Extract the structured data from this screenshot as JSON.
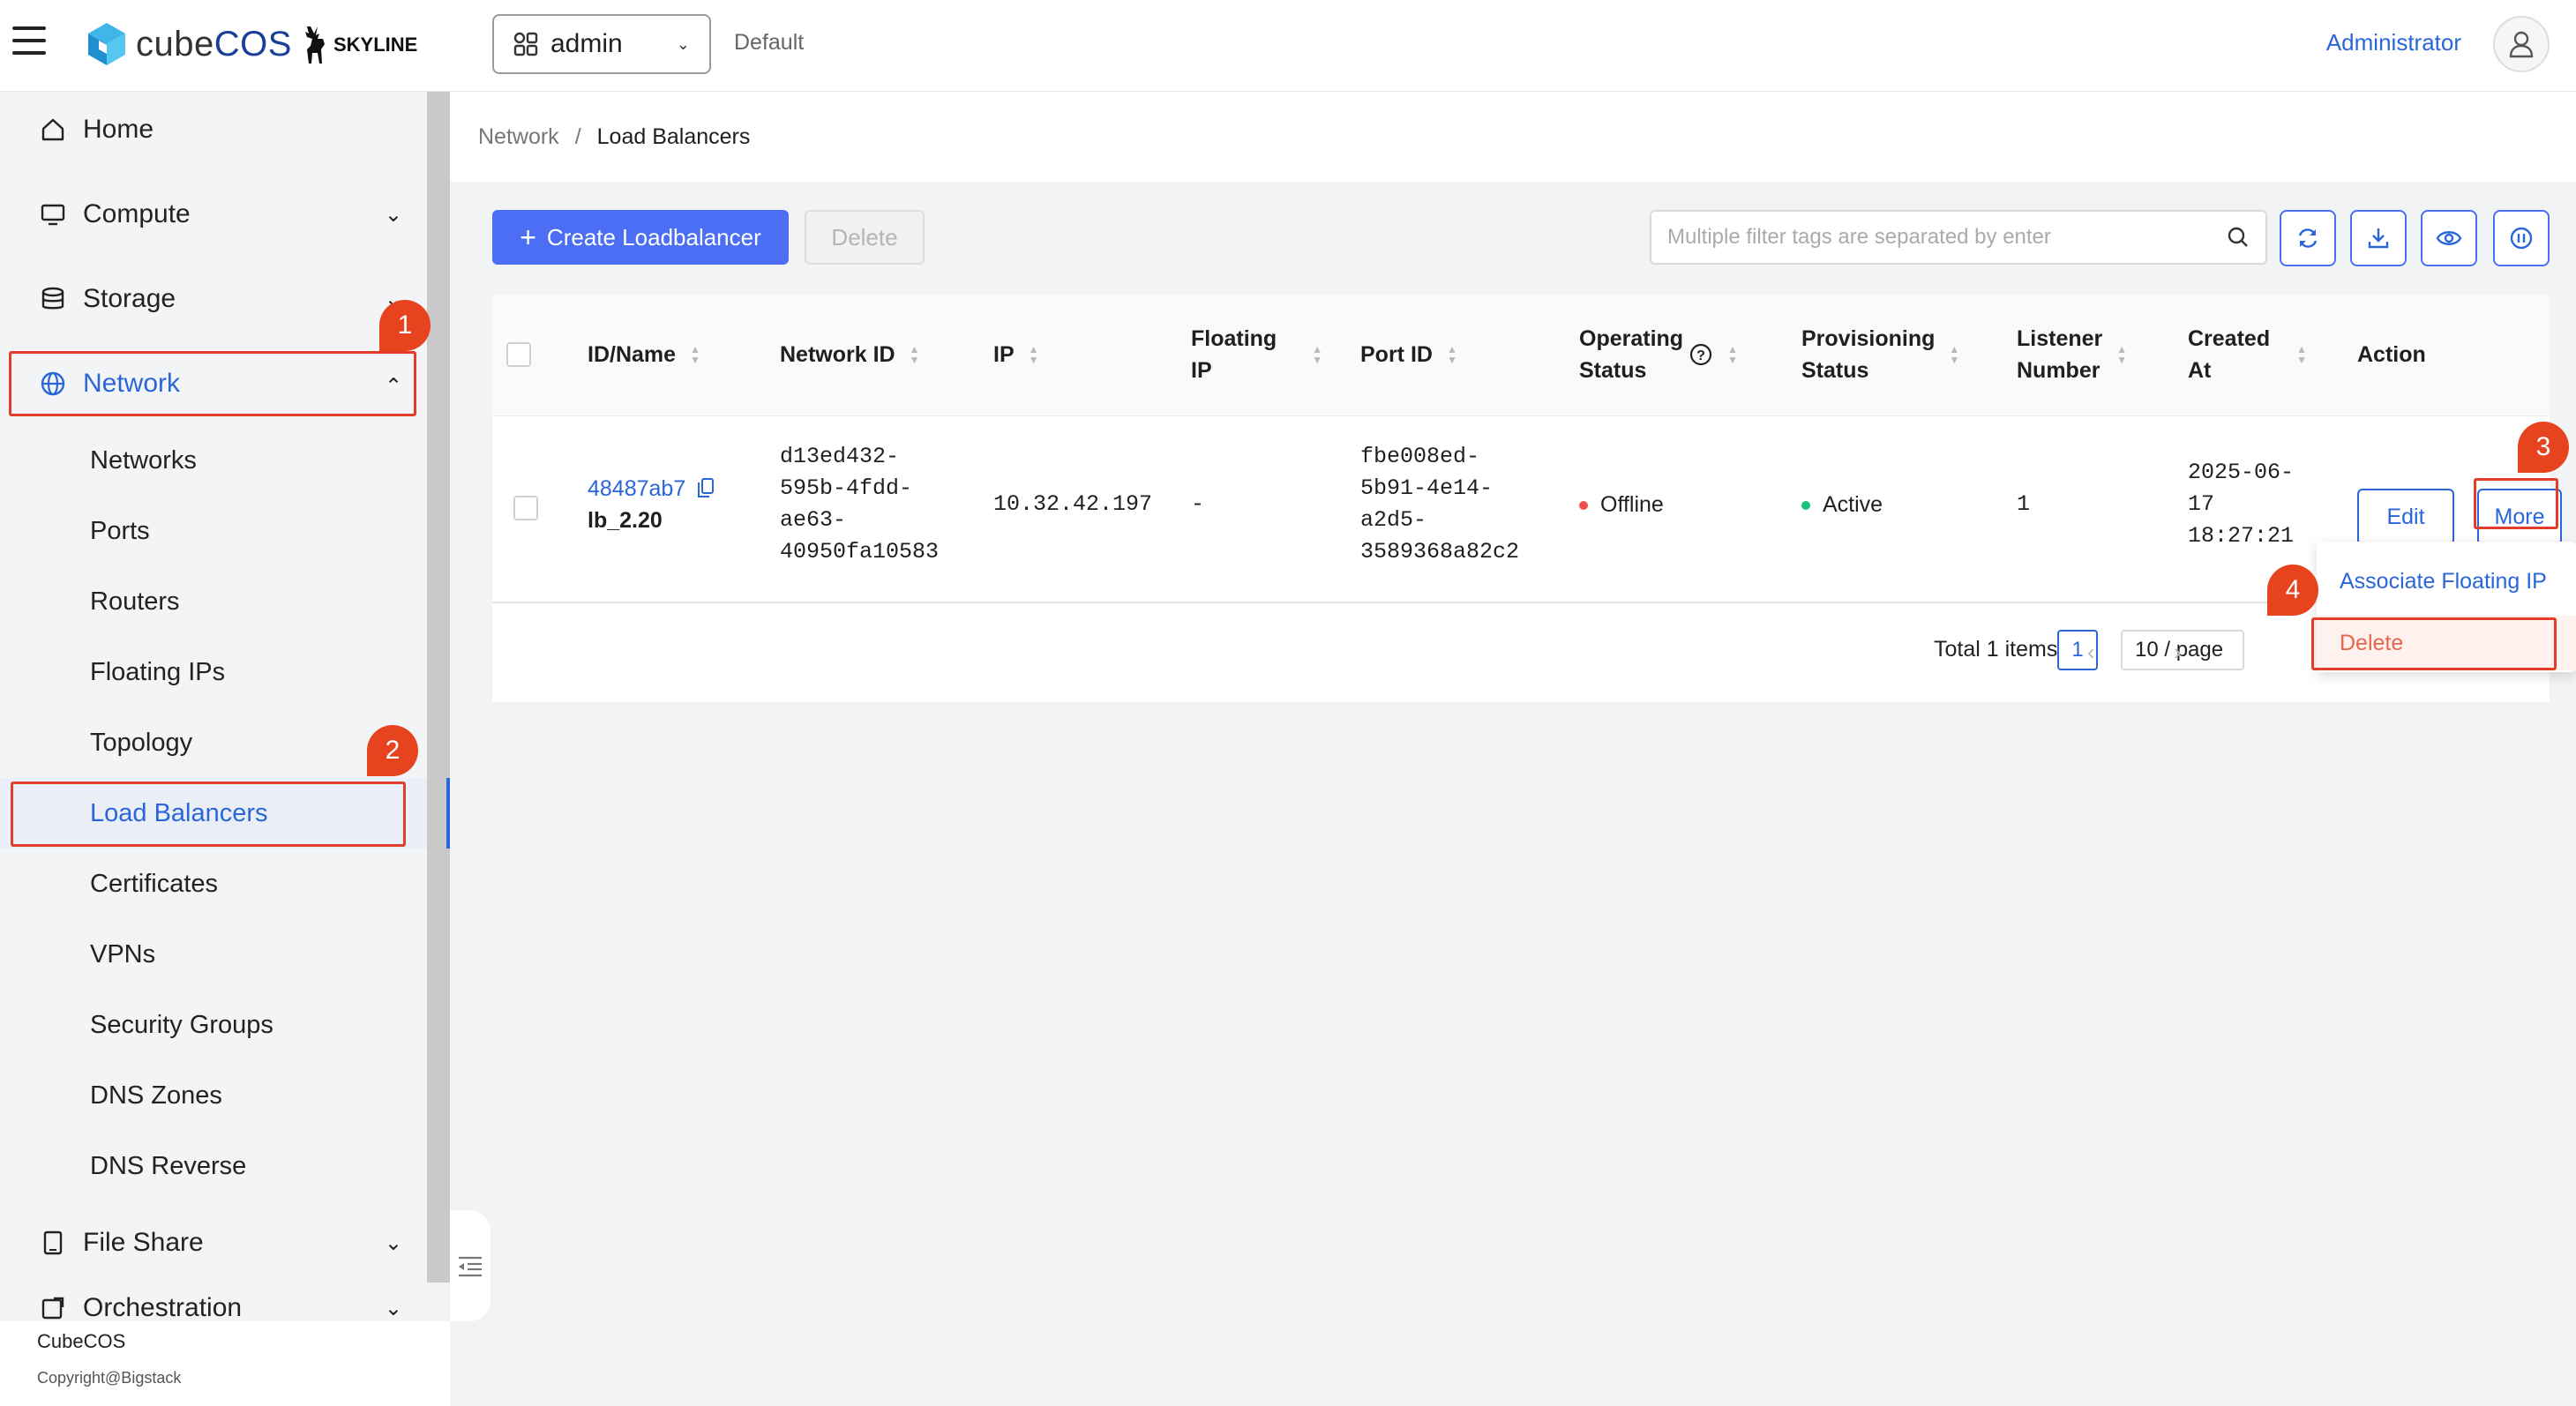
{
  "header": {
    "app_name_prefix": "cube",
    "app_name_suffix": "COS",
    "partner_logo": "SKYLINE",
    "project": "admin",
    "domain": "Default",
    "user": "Administrator"
  },
  "sidebar": {
    "items": [
      {
        "label": "Home",
        "icon": "home-icon"
      },
      {
        "label": "Compute",
        "icon": "monitor-icon"
      },
      {
        "label": "Storage",
        "icon": "database-icon"
      },
      {
        "label": "Network",
        "icon": "globe-icon"
      },
      {
        "label": "File Share",
        "icon": "file-icon"
      },
      {
        "label": "Orchestration",
        "icon": "orchestration-icon"
      }
    ],
    "network_sub": [
      "Networks",
      "Ports",
      "Routers",
      "Floating IPs",
      "Topology",
      "Load Balancers",
      "Certificates",
      "VPNs",
      "Security Groups",
      "DNS Zones",
      "DNS Reverse"
    ],
    "footer_brand": "CubeCOS",
    "footer_copy": "Copyright@Bigstack"
  },
  "breadcrumb": {
    "parent": "Network",
    "sep": "/",
    "current": "Load Balancers"
  },
  "toolbar": {
    "create_label": "Create Loadbalancer",
    "delete_label": "Delete",
    "search_placeholder": "Multiple filter tags are separated by enter"
  },
  "table": {
    "headers": {
      "id_name": "ID/Name",
      "network_id": "Network ID",
      "ip": "IP",
      "floating_ip_1": "Floating",
      "floating_ip_2": "IP",
      "port_id": "Port ID",
      "operating_1": "Operating",
      "operating_2": "Status",
      "provisioning_1": "Provisioning",
      "provisioning_2": "Status",
      "listener_1": "Listener",
      "listener_2": "Number",
      "created_1": "Created",
      "created_2": "At",
      "action": "Action"
    },
    "row": {
      "id": "48487ab7",
      "name": "lb_2.20",
      "network_id_lines": [
        "d13ed432-",
        "595b-4fdd-",
        "ae63-",
        "40950fa10583"
      ],
      "ip": "10.32.42.197",
      "floating_ip": "-",
      "port_id_lines": [
        "fbe008ed-",
        "5b91-4e14-",
        "a2d5-",
        "3589368a82c2"
      ],
      "operating_status": "Offline",
      "provisioning_status": "Active",
      "listener_number": "1",
      "created_lines": [
        "2025-06-",
        "17",
        "18:27:21"
      ],
      "edit_label": "Edit",
      "more_label": "More"
    }
  },
  "pagination": {
    "total": "Total 1 items",
    "page": "1",
    "page_size": "10 / page"
  },
  "dropdown": {
    "associate": "Associate Floating IP",
    "delete": "Delete"
  },
  "annotations": [
    "1",
    "2",
    "3",
    "4"
  ],
  "colors": {
    "accent": "#2a66d9",
    "primary_button": "#4b6ef5",
    "annotation": "#e23c2a",
    "offline": "#f0504a",
    "active": "#19c37d"
  }
}
